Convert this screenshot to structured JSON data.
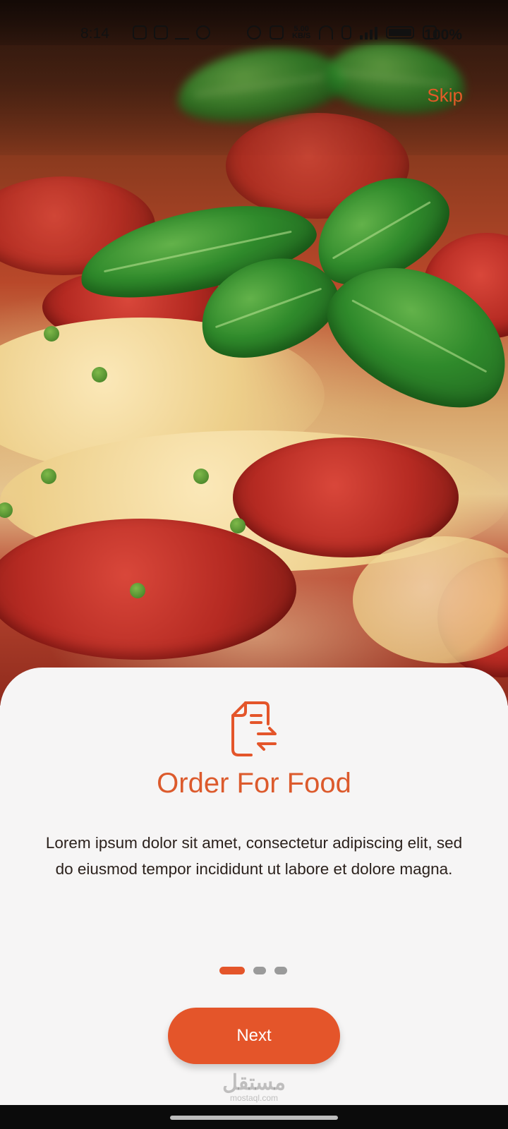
{
  "status_bar": {
    "time": "8:14",
    "net_speed_value": "5.00",
    "net_speed_unit": "KB/S",
    "battery": "100%"
  },
  "onboarding": {
    "skip_label": "Skip",
    "title": "Order For Food",
    "description": "Lorem ipsum dolor sit amet, consectetur adipiscing elit, sed do eiusmod tempor incididunt ut labore et dolore magna.",
    "page_indicator": {
      "current_page": 1,
      "total_pages": 3
    },
    "next_label": "Next",
    "icon": "order-document-transfer-icon"
  },
  "watermark": {
    "arabic": "مستقل",
    "latin": "mostaql.com"
  },
  "colors": {
    "accent": "#e4552a",
    "title": "#dc5a2c",
    "sheet_background": "#f6f5f5",
    "body_text": "#2b211c",
    "inactive_dot": "#9a9a9a"
  }
}
